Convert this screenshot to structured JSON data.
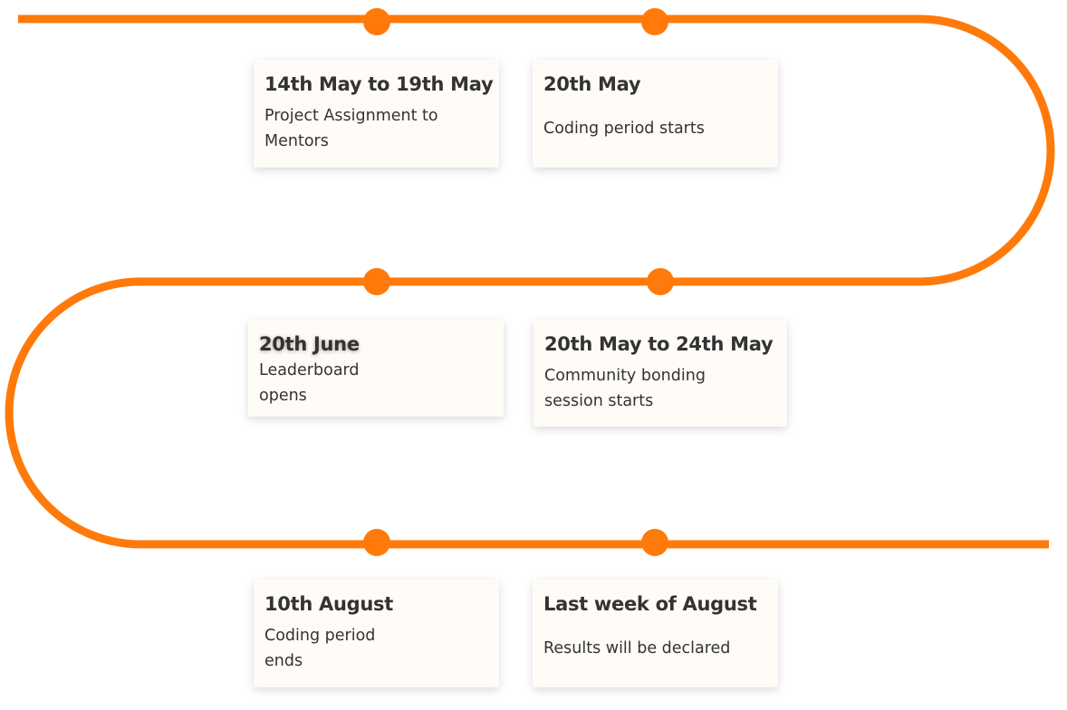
{
  "colors": {
    "track": "#ff7a0a",
    "dot": "#ff7a0a",
    "card_background": "#fffbf7",
    "text": "#333333"
  },
  "milestones": [
    {
      "date": "14th May to 19th May",
      "description": "Project Assignment to Mentors"
    },
    {
      "date": "20th May",
      "description": "Coding period starts"
    },
    {
      "date": "20th June",
      "description": "Leaderboard opens"
    },
    {
      "date": "20th May to 24th May",
      "description": "Community bonding session starts"
    },
    {
      "date": "10th August",
      "description": "Coding period ends"
    },
    {
      "date": "Last week of August",
      "description": "Results will be declared"
    }
  ]
}
